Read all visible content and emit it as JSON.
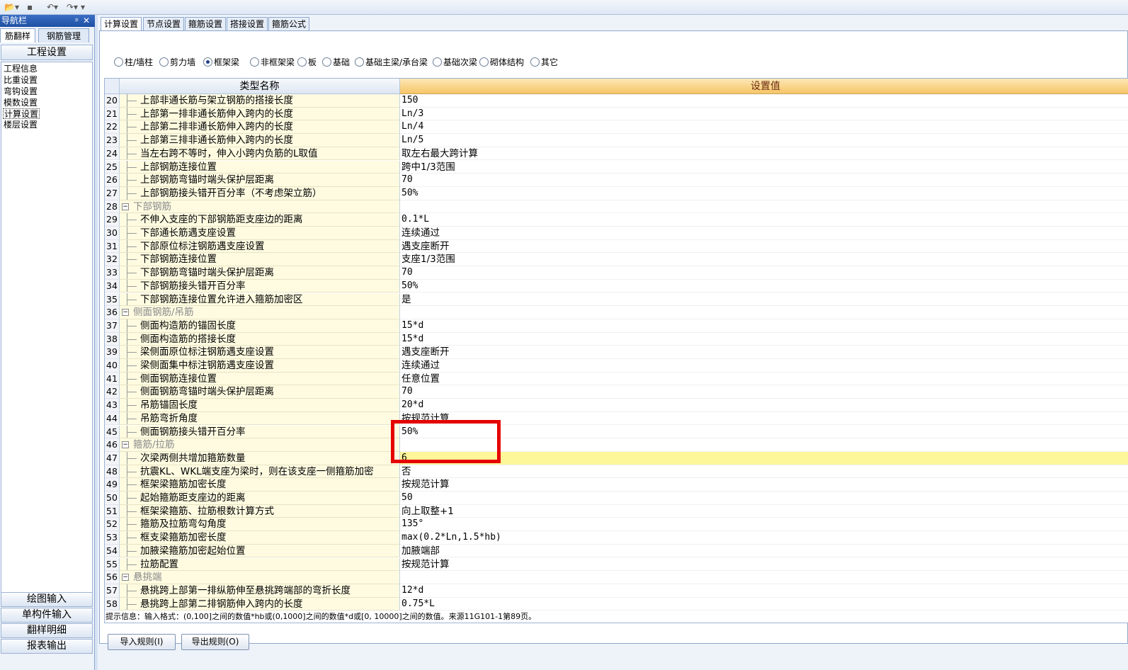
{
  "nav": {
    "title": "导航栏",
    "pin": "ᵖ",
    "close": "✕",
    "tabs": [
      "筋翻样",
      "钢筋管理"
    ],
    "section": "工程设置",
    "items": [
      "工程信息",
      "比重设置",
      "弯钩设置",
      "模数设置",
      "计算设置",
      "楼层设置"
    ],
    "selected_index": 4,
    "bottom": [
      "绘图输入",
      "单构件输入",
      "翻样明细",
      "报表输出"
    ]
  },
  "main": {
    "tabs": [
      "计算设置",
      "节点设置",
      "箍筋设置",
      "搭接设置",
      "箍筋公式"
    ],
    "active_tab": 0,
    "radios": [
      "柱/墙柱",
      "剪力墙",
      "框架梁",
      "非框架梁",
      "板",
      "基础",
      "基础主梁/承台梁",
      "基础次梁",
      "砌体结构",
      "其它"
    ],
    "radio_selected": 2
  },
  "grid": {
    "header_name": "类型名称",
    "header_value": "设置值",
    "rows": [
      {
        "n": "20",
        "name": "上部非通长筋与架立钢筋的搭接长度",
        "value": "150"
      },
      {
        "n": "21",
        "name": "上部第一排非通长筋伸入跨内的长度",
        "value": "Ln/3"
      },
      {
        "n": "22",
        "name": "上部第二排非通长筋伸入跨内的长度",
        "value": "Ln/4"
      },
      {
        "n": "23",
        "name": "上部第三排非通长筋伸入跨内的长度",
        "value": "Ln/5"
      },
      {
        "n": "24",
        "name": "当左右跨不等时，伸入小跨内负筋的L取值",
        "value": "取左右最大跨计算"
      },
      {
        "n": "25",
        "name": "上部钢筋连接位置",
        "value": "跨中1/3范围"
      },
      {
        "n": "26",
        "name": "上部钢筋弯锚时端头保护层距离",
        "value": "70"
      },
      {
        "n": "27",
        "name": "上部钢筋接头错开百分率（不考虑架立筋）",
        "value": "50%"
      },
      {
        "n": "28",
        "name": "下部钢筋",
        "value": "",
        "group": true
      },
      {
        "n": "29",
        "name": "不伸入支座的下部钢筋距支座边的距离",
        "value": "0.1*L"
      },
      {
        "n": "30",
        "name": "下部通长筋遇支座设置",
        "value": "连续通过"
      },
      {
        "n": "31",
        "name": "下部原位标注钢筋遇支座设置",
        "value": "遇支座断开"
      },
      {
        "n": "32",
        "name": "下部钢筋连接位置",
        "value": "支座1/3范围"
      },
      {
        "n": "33",
        "name": "下部钢筋弯锚时端头保护层距离",
        "value": "70"
      },
      {
        "n": "34",
        "name": "下部钢筋接头错开百分率",
        "value": "50%"
      },
      {
        "n": "35",
        "name": "下部钢筋连接位置允许进入箍筋加密区",
        "value": "是"
      },
      {
        "n": "36",
        "name": "侧面钢筋/吊筋",
        "value": "",
        "group": true
      },
      {
        "n": "37",
        "name": "侧面构造筋的锚固长度",
        "value": "15*d"
      },
      {
        "n": "38",
        "name": "侧面构造筋的搭接长度",
        "value": "15*d"
      },
      {
        "n": "39",
        "name": "梁侧面原位标注钢筋遇支座设置",
        "value": "遇支座断开"
      },
      {
        "n": "40",
        "name": "梁侧面集中标注钢筋遇支座设置",
        "value": "连续通过"
      },
      {
        "n": "41",
        "name": "侧面钢筋连接位置",
        "value": "任意位置"
      },
      {
        "n": "42",
        "name": "侧面钢筋弯锚时端头保护层距离",
        "value": "70"
      },
      {
        "n": "43",
        "name": "吊筋锚固长度",
        "value": "20*d"
      },
      {
        "n": "44",
        "name": "吊筋弯折角度",
        "value": "按规范计算"
      },
      {
        "n": "45",
        "name": "侧面钢筋接头错开百分率",
        "value": "50%"
      },
      {
        "n": "46",
        "name": "箍筋/拉筋",
        "value": "",
        "group": true
      },
      {
        "n": "47",
        "name": "次梁两侧共增加箍筋数量",
        "value": "6",
        "highlight": true
      },
      {
        "n": "48",
        "name": "抗震KL、WKL端支座为梁时，则在该支座一侧箍筋加密",
        "value": "否"
      },
      {
        "n": "49",
        "name": "框架梁箍筋加密长度",
        "value": "按规范计算"
      },
      {
        "n": "50",
        "name": "起始箍筋距支座边的距离",
        "value": "50"
      },
      {
        "n": "51",
        "name": "框架梁箍筋、拉筋根数计算方式",
        "value": "向上取整+1"
      },
      {
        "n": "52",
        "name": "箍筋及拉筋弯勾角度",
        "value": "135°"
      },
      {
        "n": "53",
        "name": "框支梁箍筋加密长度",
        "value": "max(0.2*Ln,1.5*hb)"
      },
      {
        "n": "54",
        "name": "加腋梁箍筋加密起始位置",
        "value": "加腋端部"
      },
      {
        "n": "55",
        "name": "拉筋配置",
        "value": "按规范计算"
      },
      {
        "n": "56",
        "name": "悬挑端",
        "value": "",
        "group": true
      },
      {
        "n": "57",
        "name": "悬挑跨上部第一排纵筋伸至悬挑跨端部的弯折长度",
        "value": "12*d"
      },
      {
        "n": "58",
        "name": "悬挑跨上部第二排钢筋伸入跨内的长度",
        "value": "0.75*L"
      }
    ]
  },
  "hint": "提示信息：输入格式：(0,100]之间的数值*hb或(0,1000]之间的数值*d或[0, 10000]之间的数值。来源11G101-1第89页。",
  "buttons": {
    "import": "导入规则(I)",
    "export": "导出规则(O)"
  },
  "colors": {
    "header_value_bg": "#f6c567",
    "name_cell_bg": "#fefbe1",
    "highlight_row": "#fdf79a",
    "annotation_box": "#e50000"
  }
}
